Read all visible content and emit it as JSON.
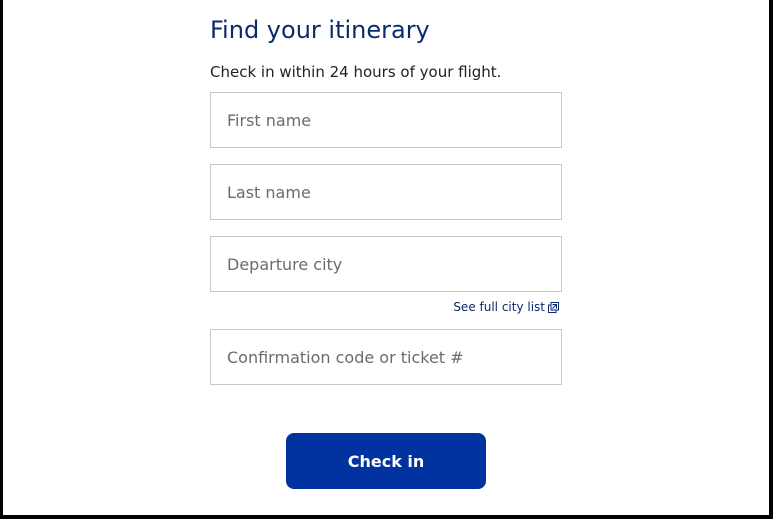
{
  "form": {
    "title": "Find your itinerary",
    "subtitle": "Check in within 24 hours of your flight.",
    "first_name_placeholder": "First name",
    "last_name_placeholder": "Last name",
    "departure_city_placeholder": "Departure city",
    "city_list_link": "See full city list",
    "confirmation_placeholder": "Confirmation code or ticket #",
    "submit_label": "Check in"
  },
  "colors": {
    "title": "#0b2a6b",
    "button": "#0033a0",
    "link": "#0b2a6b",
    "border": "#c8c8c8"
  },
  "icons": {
    "city_list": "external-window-icon"
  }
}
